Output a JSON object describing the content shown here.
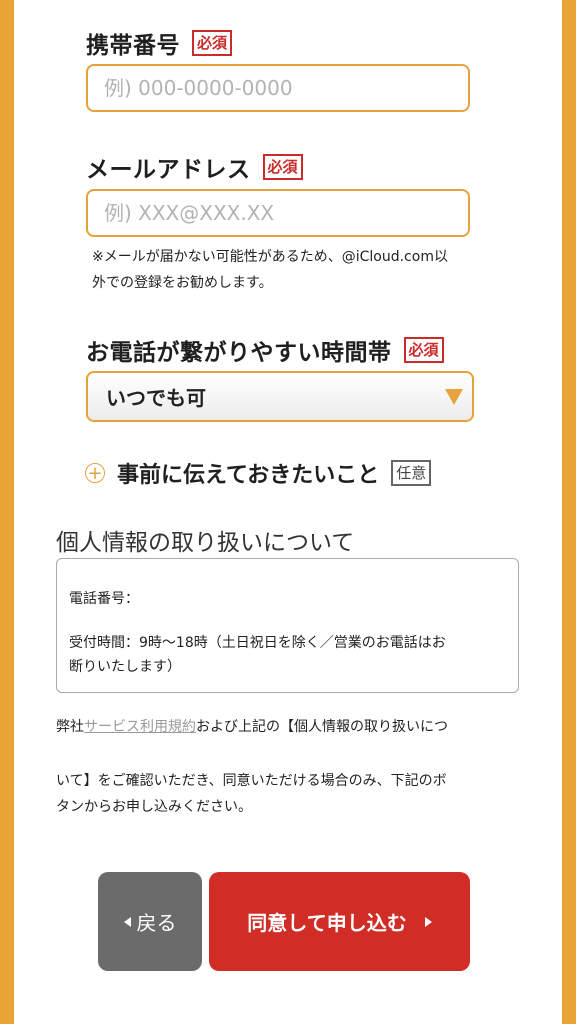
{
  "colors": {
    "accent": "#e9a435",
    "required": "#cc2b2b",
    "submit": "#d12d27",
    "back": "#6b6b6b"
  },
  "phone": {
    "label": "携帯番号",
    "badge": "必須",
    "placeholder": "例) 000-0000-0000",
    "value": ""
  },
  "email": {
    "label": "メールアドレス",
    "badge": "必須",
    "placeholder": "例) XXX@XXX.XX",
    "value": "",
    "note_line1": "※メールが届かない可能性があるため、@iCloud.com以",
    "note_line2": "外での登録をお勧めします。"
  },
  "call_time": {
    "label": "お電話が繋がりやすい時間帯",
    "badge": "必須",
    "selected": "いつでも可",
    "icon": "triangle-down-icon"
  },
  "extra": {
    "label": "事前に伝えておきたいこと",
    "badge": "任意",
    "icon": "plus-circle-icon"
  },
  "privacy": {
    "title": "個人情報の取り扱いについて",
    "line1": "電話番号：",
    "line2": "受付時間：9時〜18時（土日祝日を除く／営業のお電話はお",
    "line3": "断りいたします）"
  },
  "agreement": {
    "prefix": "弊社",
    "link": "サービス利用規約",
    "suffix": "および上記の【個人情報の取り扱いにつ",
    "line2": "いて】をご確認いただき、同意いただける場合のみ、下記のボ",
    "line3": "タンからお申し込みください。"
  },
  "buttons": {
    "back": "戻る",
    "submit": "同意して申し込む"
  }
}
